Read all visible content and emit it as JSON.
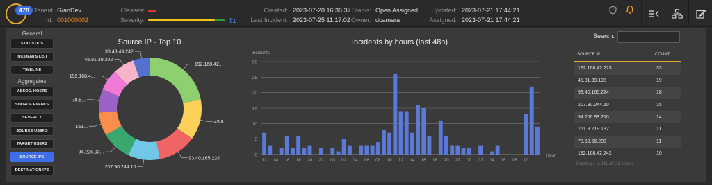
{
  "header": {
    "badge_count": "478",
    "tenant_label": "Tenant",
    "tenant_value": "GianDev",
    "id_label": "Id:",
    "id_value": "001000002",
    "classes_label": "Classes:",
    "severity_label": "Severity:",
    "severity_level": "T1",
    "created_label": "Created:",
    "created_value": "2023-07-20 16:36:37",
    "last_incident_label": "Last Incident:",
    "last_incident_value": "2023-07-25 11:17:02",
    "status_label": "Status:",
    "status_value": "Open Assigned",
    "owner_label": "Owner:",
    "owner_value": "dcamera",
    "updated_label": "Updated:",
    "updated_value": "2023-07-21 17:44:21",
    "assigned_label": "Assigned:",
    "assigned_value": "2023-07-21 17:44:21",
    "colors": {
      "classes": "#dd3333",
      "severity": "#f0c419",
      "accent": "#3f6ee8"
    }
  },
  "sidebar": {
    "general_title": "General",
    "general_items": [
      {
        "label": "Statistics"
      },
      {
        "label": "Incidents List"
      },
      {
        "label": "Timeline"
      }
    ],
    "aggregates_title": "Aggregates",
    "aggregate_items": [
      {
        "label": "Assoc. Hosts"
      },
      {
        "label": "Source Events"
      },
      {
        "label": "Severity"
      },
      {
        "label": "Source Users"
      },
      {
        "label": "Target Users"
      },
      {
        "label": "Source IPs"
      },
      {
        "label": "Destination IPs"
      }
    ],
    "active": "Source IPs"
  },
  "search": {
    "label": "Search:",
    "value": ""
  },
  "table": {
    "headers": [
      "Source IP",
      "Count"
    ],
    "rows": [
      [
        "192.168.42.223",
        "33"
      ],
      [
        "45.81.39.198",
        "19"
      ],
      [
        "93.40.165.224",
        "18"
      ],
      [
        "207.90.244.10",
        "15"
      ],
      [
        "94.206.93.210",
        "14"
      ],
      [
        "151.8.219.132",
        "11"
      ],
      [
        "78.50.56.203",
        "11"
      ],
      [
        "192.168.42.242",
        "10"
      ]
    ],
    "info": "Showing 1 to 211 of 211 entries"
  },
  "chart_data": [
    {
      "type": "pie",
      "title": "Source IP - Top 10",
      "labels": [
        "192.168.42...",
        "45.8...",
        "93.40.165.224",
        "207.90.244.10",
        "94.206.93...",
        "151...",
        "78.5...",
        "192.168.4...",
        "45.81.39.202",
        "93.43.49.242"
      ],
      "values": [
        33,
        19,
        18,
        15,
        14,
        11,
        11,
        10,
        10,
        8
      ],
      "colors": [
        "#8ecf6f",
        "#fcd15a",
        "#f06464",
        "#70c7e8",
        "#3aa86e",
        "#fb8e4c",
        "#9a62c6",
        "#f07ad8",
        "#f7b3c7",
        "#5471cf"
      ]
    },
    {
      "type": "bar",
      "title": "Incidents by hours (last 48h)",
      "ylabel": "Incidents",
      "xlabel": "Hour",
      "ylim": [
        0,
        30
      ],
      "yticks": [
        0,
        5,
        10,
        15,
        20,
        25,
        30
      ],
      "xtick_labels": [
        "12",
        "14",
        "16",
        "18",
        "20",
        "22",
        "00",
        "02",
        "04",
        "06",
        "08",
        "10",
        "12",
        "14",
        "16",
        "18",
        "20",
        "22",
        "00",
        "02",
        "04",
        "06",
        "08",
        "10"
      ],
      "values": [
        7,
        3,
        0,
        2,
        6,
        2,
        6,
        2,
        3,
        0,
        2,
        0,
        2,
        1,
        5,
        3,
        0,
        3,
        3,
        3,
        4,
        8,
        7,
        26,
        14,
        14,
        7,
        16,
        15,
        6,
        0,
        11,
        6,
        3,
        3,
        2,
        2,
        0,
        3,
        0,
        1,
        3,
        0,
        0,
        0,
        0,
        13,
        22,
        9
      ],
      "color": "#5b79d6"
    }
  ]
}
